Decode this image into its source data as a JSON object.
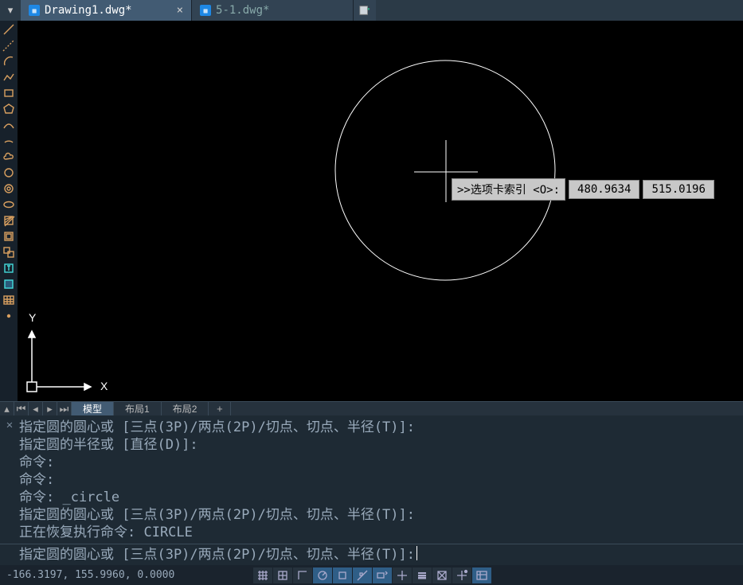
{
  "tabs": {
    "active": {
      "label": "Drawing1.dwg*"
    },
    "inactive1": {
      "label": "5-1.dwg*"
    }
  },
  "dynamic_prompt": ">>选项卡索引 <O>:",
  "dynamic_coord_x": "480.9634",
  "dynamic_coord_y": "515.0196",
  "ucs_labels": {
    "x": "X",
    "y": "Y"
  },
  "layout_tabs": {
    "model": "模型",
    "layout1": "布局1",
    "layout2": "布局2",
    "add": "+"
  },
  "cmd_history": [
    "指定圆的圆心或 [三点(3P)/两点(2P)/切点、切点、半径(T)]:",
    "指定圆的半径或 [直径(D)]:",
    "命令:",
    "命令:",
    "命令: _circle",
    "指定圆的圆心或 [三点(3P)/两点(2P)/切点、切点、半径(T)]:",
    "正在恢复执行命令: CIRCLE"
  ],
  "cmd_prompt": "指定圆的圆心或 [三点(3P)/两点(2P)/切点、切点、半径(T)]: ",
  "status_coords": "-166.3197, 155.9960, 0.0000",
  "colors": {
    "bg_canvas": "#000000",
    "panel": "#1e2a34",
    "accent": "#425b73",
    "icon": "#d9a060"
  }
}
